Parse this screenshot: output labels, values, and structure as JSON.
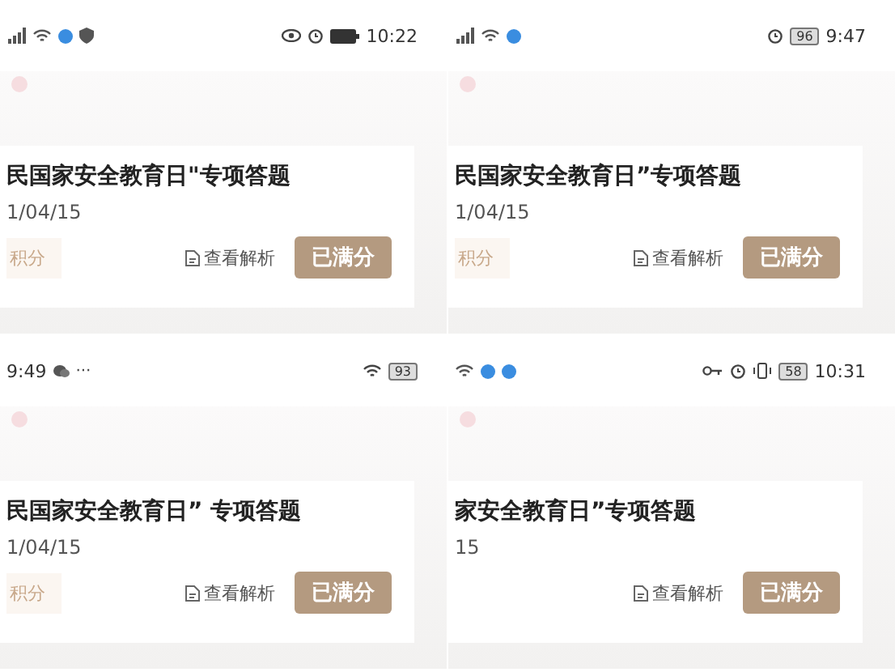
{
  "panels": [
    {
      "status": {
        "right_time": "10:22"
      },
      "card": {
        "title": "民国家安全教育日\"专项答题",
        "date": "1/04/15",
        "points": "积分",
        "analysis_link": "查看解析",
        "score_button": "已满分"
      }
    },
    {
      "status": {
        "battery": "96",
        "right_time": "9:47"
      },
      "card": {
        "title": "民国家安全教育日”专项答题",
        "date": "1/04/15",
        "points": "积分",
        "analysis_link": "查看解析",
        "score_button": "已满分"
      }
    },
    {
      "status": {
        "left_time": "9:49",
        "more": "···",
        "battery": "93"
      },
      "card": {
        "title": "民国家安全教育日” 专项答题",
        "date": "1/04/15",
        "points": "积分",
        "analysis_link": "查看解析",
        "score_button": "已满分"
      }
    },
    {
      "status": {
        "battery": "58",
        "right_time": "10:31"
      },
      "card": {
        "title": "家安全教育日”专项答题",
        "date": "15",
        "analysis_link": "查看解析",
        "score_button": "已满分"
      }
    }
  ]
}
